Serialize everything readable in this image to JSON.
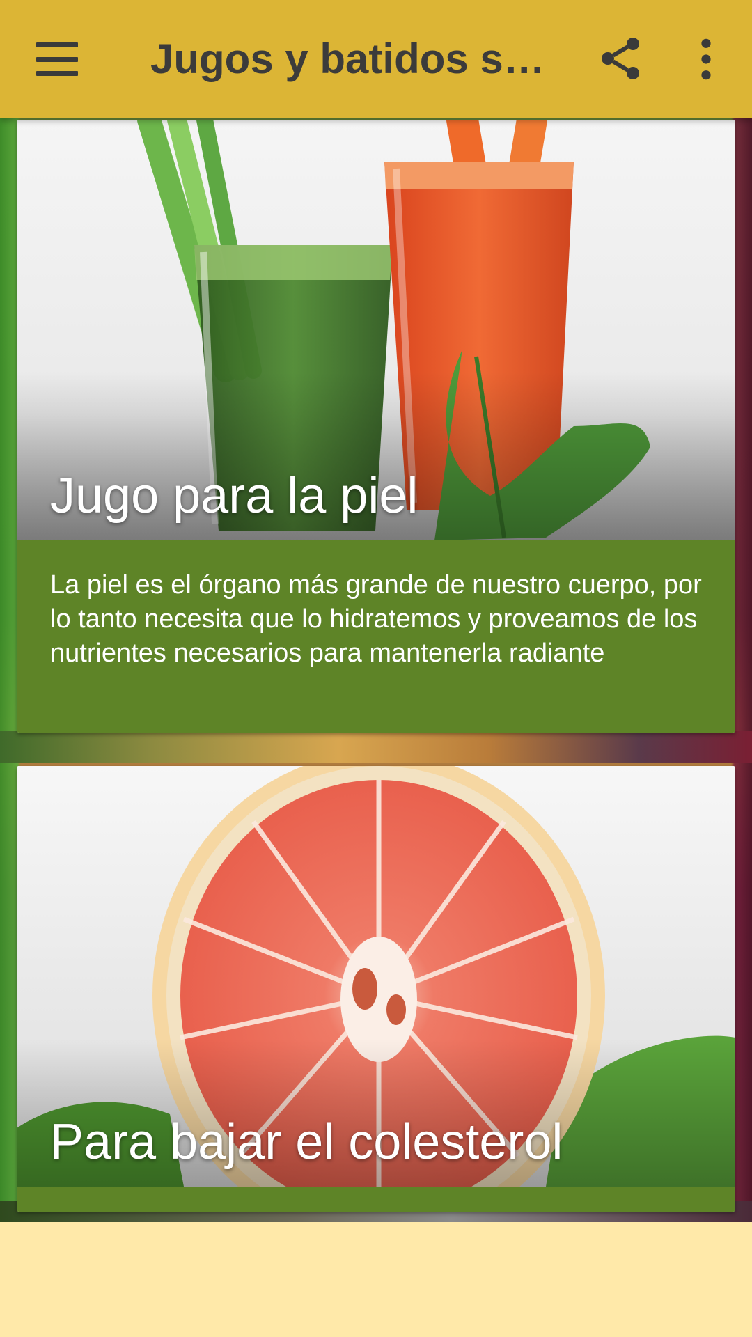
{
  "appbar": {
    "title": "Jugos y batidos sal…",
    "menu_icon": "menu-icon",
    "share_icon": "share-icon",
    "more_icon": "more-vert-icon",
    "background": "#dcb535"
  },
  "cards": [
    {
      "title": "Jugo para la piel",
      "description": "La piel es el órgano más grande de nuestro cuerpo, por lo tanto necesita que lo hidratemos y proveamos de los nutrientes necesarios para mantenerla radiante",
      "image": "green-and-orange-juice-glasses",
      "accent": "#5e8427"
    },
    {
      "title": "Para bajar el colesterol",
      "description": "",
      "image": "grapefruit-half",
      "accent": "#5e8427"
    }
  ],
  "banner": {
    "background": "#ffe9a9"
  }
}
